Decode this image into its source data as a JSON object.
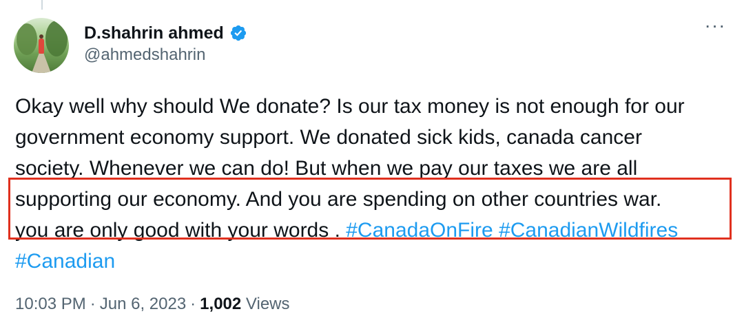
{
  "author": {
    "display_name": "D.shahrin ahmed",
    "handle": "@ahmedshahrin",
    "avatar_icon": "profile-photo",
    "verified_icon": "verified-badge-icon",
    "verified_color": "#1d9bf0"
  },
  "more_options": {
    "label": "···",
    "icon": "more-options-icon"
  },
  "tweet": {
    "line1": "Okay well why should We donate? Is our tax money is not enough for our",
    "line2": "government economy support. We donated sick kids, canada cancer",
    "line3": "society. Whenever we can do! But when we pay our taxes we are all",
    "line4": "supporting our economy. And you are spending on other countries war.",
    "line5_text": "you are only good with your words . ",
    "hashtags": [
      "#CanadaOnFire",
      "#CanadianWildfires",
      "#Canadian"
    ],
    "hashtag_color": "#1d9bf0"
  },
  "highlight": {
    "color": "#e0301e"
  },
  "meta": {
    "time": "10:03 PM",
    "separator": "·",
    "date": "Jun 6, 2023",
    "views_count": "1,002",
    "views_label": "Views"
  }
}
